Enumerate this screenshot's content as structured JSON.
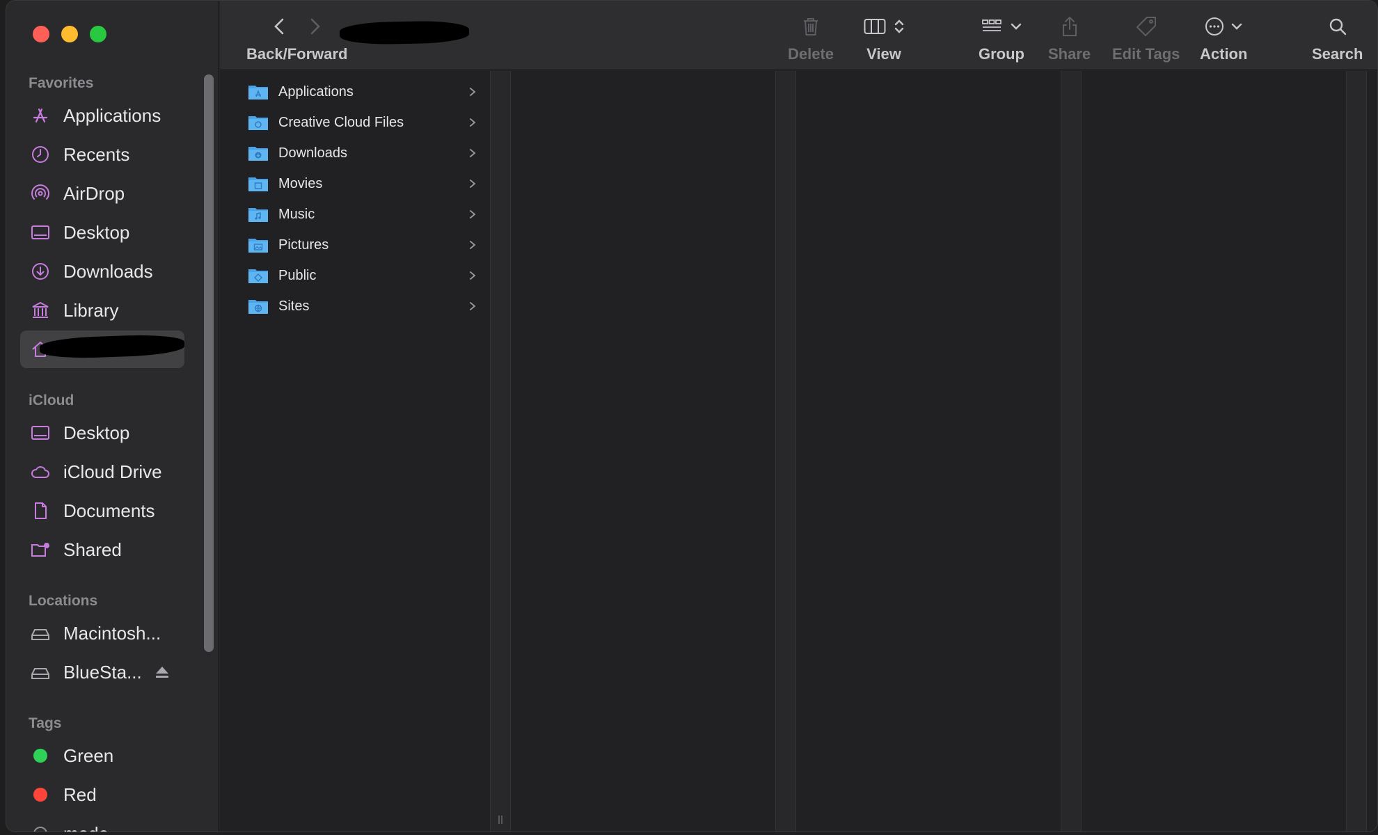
{
  "window": {
    "traffic_lights": {
      "close": "#fe5f57",
      "minimize": "#febc2e",
      "zoom": "#28c840"
    }
  },
  "sidebar": {
    "sections": {
      "favorites": "Favorites",
      "icloud": "iCloud",
      "locations": "Locations",
      "tags": "Tags"
    },
    "favorites": [
      {
        "label": "Applications",
        "icon": "applications-icon"
      },
      {
        "label": "Recents",
        "icon": "clock-icon"
      },
      {
        "label": "AirDrop",
        "icon": "airdrop-icon"
      },
      {
        "label": "Desktop",
        "icon": "desktop-icon"
      },
      {
        "label": "Downloads",
        "icon": "download-icon"
      },
      {
        "label": "Library",
        "icon": "library-icon"
      },
      {
        "label": "",
        "icon": "home-icon",
        "selected": true
      }
    ],
    "icloud": [
      {
        "label": "Desktop",
        "icon": "desktop-icon"
      },
      {
        "label": "iCloud Drive",
        "icon": "cloud-icon"
      },
      {
        "label": "Documents",
        "icon": "document-icon"
      },
      {
        "label": "Shared",
        "icon": "shared-folder-icon"
      }
    ],
    "locations": [
      {
        "label": "Macintosh...",
        "icon": "drive-icon"
      },
      {
        "label": "BlueSta...",
        "icon": "drive-icon",
        "ejectable": true
      }
    ],
    "tags": [
      {
        "label": "Green",
        "color": "#30d158"
      },
      {
        "label": "Red",
        "color": "#ff453a"
      },
      {
        "label": "mode",
        "color": "#8e8e93"
      }
    ],
    "accent_color": "#c77dde"
  },
  "toolbar": {
    "back_forward_label": "Back/Forward",
    "delete_label": "Delete",
    "view_label": "View",
    "group_label": "Group",
    "share_label": "Share",
    "edit_tags_label": "Edit Tags",
    "action_label": "Action",
    "search_label": "Search"
  },
  "column1": {
    "items": [
      {
        "name": "Applications",
        "icon": "applications-folder-icon"
      },
      {
        "name": "Creative Cloud Files",
        "icon": "creative-cloud-folder-icon"
      },
      {
        "name": "Downloads",
        "icon": "downloads-folder-icon"
      },
      {
        "name": "Movies",
        "icon": "movies-folder-icon"
      },
      {
        "name": "Music",
        "icon": "music-folder-icon"
      },
      {
        "name": "Pictures",
        "icon": "pictures-folder-icon"
      },
      {
        "name": "Public",
        "icon": "public-folder-icon"
      },
      {
        "name": "Sites",
        "icon": "sites-folder-icon"
      }
    ],
    "folder_color": "#4aa3e8"
  }
}
